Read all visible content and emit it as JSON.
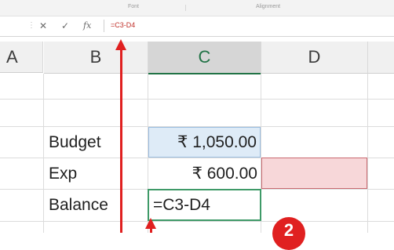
{
  "ribbon": {
    "groups": [
      "Font",
      "Alignment"
    ]
  },
  "formula_bar": {
    "cancel_icon": "✕",
    "enter_icon": "✓",
    "fx_label": "fx",
    "content": "=C3-D4"
  },
  "columns": [
    "A",
    "B",
    "C",
    "D"
  ],
  "rows": [
    {
      "label": "Budget",
      "value": "₹ 1,050.00"
    },
    {
      "label": "Exp",
      "value": "₹ 600.00"
    },
    {
      "label": "Balance",
      "value": "=C3-D4"
    }
  ],
  "annotation": {
    "badge_number": "2",
    "color": "#e02020"
  },
  "colors": {
    "selected_column": "#217346",
    "highlight_blue": "#deebf7",
    "highlight_red": "#f7d7d9"
  }
}
